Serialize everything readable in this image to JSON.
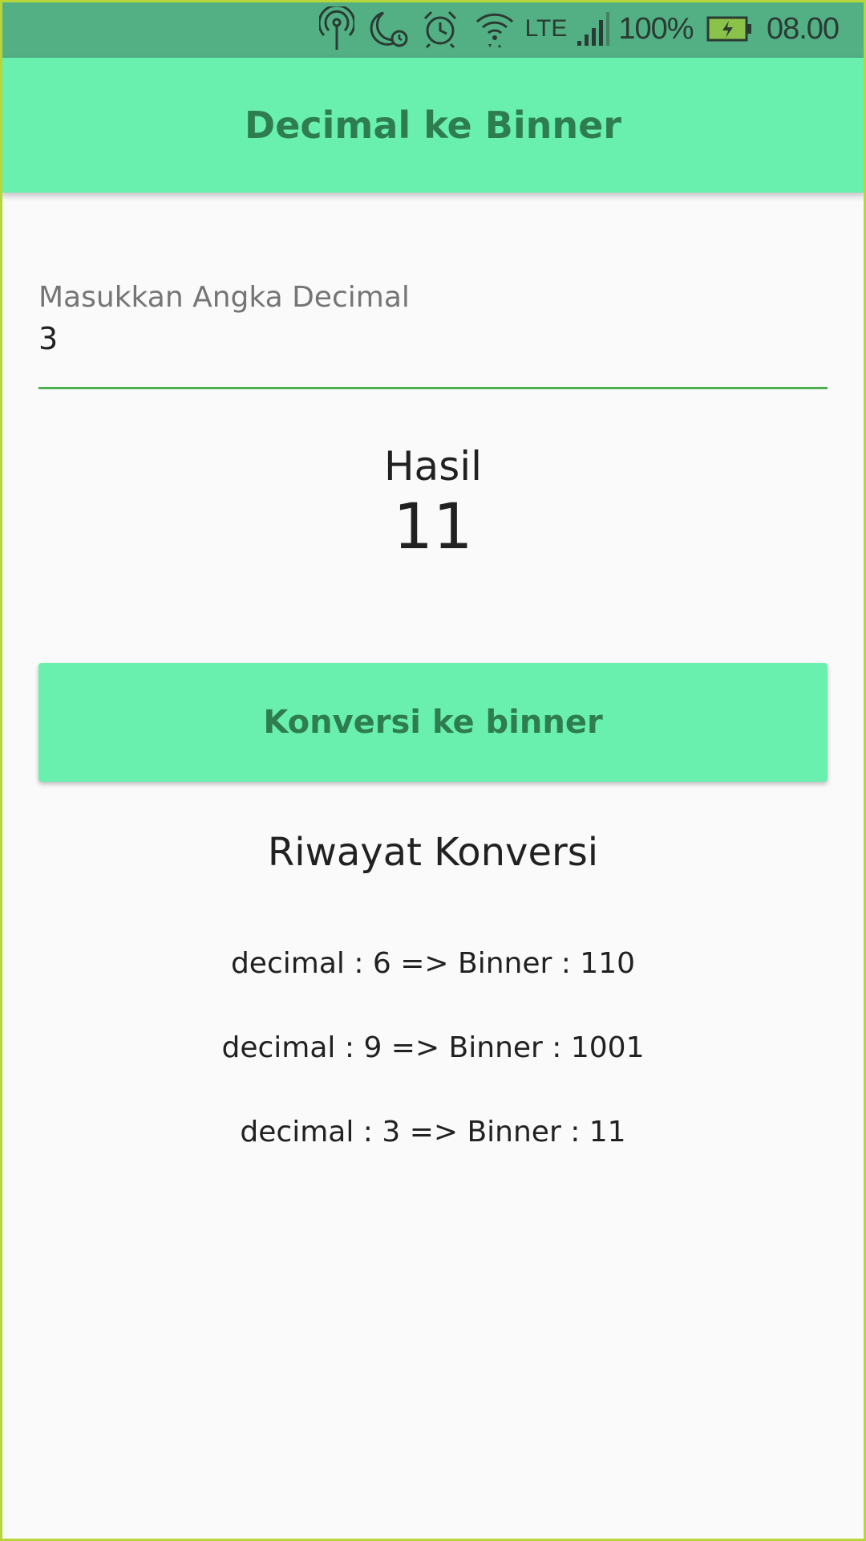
{
  "status_bar": {
    "icons": [
      "hotspot-icon",
      "do-not-disturb-icon",
      "alarm-icon",
      "wifi-icon",
      "lte-icon",
      "signal-icon",
      "battery-charging-icon"
    ],
    "network": "LTE",
    "battery": "100%",
    "time": "08.00"
  },
  "app_bar": {
    "title": "Decimal ke Binner"
  },
  "input": {
    "label": "Masukkan Angka Decimal",
    "value": "3"
  },
  "result": {
    "label": "Hasil",
    "value": "11"
  },
  "button": {
    "label": "Konversi ke binner"
  },
  "history": {
    "title": "Riwayat Konversi",
    "items": [
      "decimal : 6 => Binner : 110",
      "decimal : 9 => Binner : 1001",
      "decimal : 3 => Binner : 11"
    ]
  },
  "colors": {
    "accent": "#69f0ae",
    "accent_text": "#2e7d50",
    "status_bar": "#52b084",
    "underline": "#4caf50"
  }
}
